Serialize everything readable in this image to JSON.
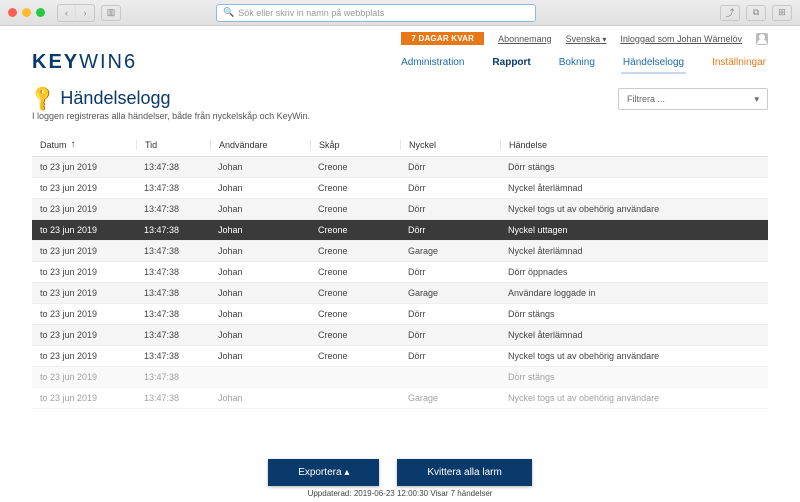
{
  "chrome": {
    "url_placeholder": "Sök eller skriv in namn på webbplats"
  },
  "util": {
    "days_badge": "7 DAGAR KVAR",
    "subscription": "Abonnemang",
    "language": "Svenska",
    "logged_in_as": "Inloggad som Johan Wärnelöv"
  },
  "logo": {
    "brand": "KEY",
    "brand2": "WIN",
    "ver": "6"
  },
  "nav": {
    "administration": "Administration",
    "rapport": "Rapport",
    "bokning": "Bokning",
    "handelselogg": "Händelselogg",
    "installningar": "Inställningar"
  },
  "page": {
    "title": "Händelselogg",
    "subtitle": "I loggen registreras alla händelser, både från nyckelskåp och KeyWin.",
    "filter_label": "Filtrera ..."
  },
  "columns": {
    "datum": "Datum",
    "tid": "Tid",
    "anvandare": "Andvändare",
    "skap": "Skåp",
    "nyckel": "Nyckel",
    "handelse": "Händelse"
  },
  "rows": [
    {
      "datum": "to 23 jun 2019",
      "tid": "13:47:38",
      "anv": "Johan",
      "skap": "Creone",
      "nyckel": "Dörr",
      "hand": "Dörr stängs",
      "sel": false
    },
    {
      "datum": "to 23 jun 2019",
      "tid": "13:47:38",
      "anv": "Johan",
      "skap": "Creone",
      "nyckel": "Dörr",
      "hand": "Nyckel återlämnad",
      "sel": false
    },
    {
      "datum": "to 23 jun 2019",
      "tid": "13:47:38",
      "anv": "Johan",
      "skap": "Creone",
      "nyckel": "Dörr",
      "hand": "Nyckel togs ut av obehörig användare",
      "sel": false
    },
    {
      "datum": "to 23 jun 2019",
      "tid": "13:47:38",
      "anv": "Johan",
      "skap": "Creone",
      "nyckel": "Dörr",
      "hand": "Nyckel uttagen",
      "sel": true
    },
    {
      "datum": "to 23 jun 2019",
      "tid": "13:47:38",
      "anv": "Johan",
      "skap": "Creone",
      "nyckel": "Garage",
      "hand": "Nyckel återlämnad",
      "sel": false
    },
    {
      "datum": "to 23 jun 2019",
      "tid": "13:47:38",
      "anv": "Johan",
      "skap": "Creone",
      "nyckel": "Dörr",
      "hand": "Dörr öppnades",
      "sel": false
    },
    {
      "datum": "to 23 jun 2019",
      "tid": "13:47:38",
      "anv": "Johan",
      "skap": "Creone",
      "nyckel": "Garage",
      "hand": "Användare loggade in",
      "sel": false
    },
    {
      "datum": "to 23 jun 2019",
      "tid": "13:47:38",
      "anv": "Johan",
      "skap": "Creone",
      "nyckel": "Dörr",
      "hand": "Dörr stängs",
      "sel": false
    },
    {
      "datum": "to 23 jun 2019",
      "tid": "13:47:38",
      "anv": "Johan",
      "skap": "Creone",
      "nyckel": "Dörr",
      "hand": "Nyckel återlämnad",
      "sel": false
    },
    {
      "datum": "to 23 jun 2019",
      "tid": "13:47:38",
      "anv": "Johan",
      "skap": "Creone",
      "nyckel": "Dörr",
      "hand": "Nyckel togs ut av obehörig användare",
      "sel": false
    },
    {
      "datum": "to 23 jun 2019",
      "tid": "13:47:38",
      "anv": "",
      "skap": "",
      "nyckel": "",
      "hand": "Dörr stängs",
      "sel": false,
      "faded": true
    },
    {
      "datum": "to 23 jun 2019",
      "tid": "13:47:38",
      "anv": "Johan",
      "skap": "",
      "nyckel": "Garage",
      "hand": "Nyckel togs ut av obehörig användare",
      "sel": false,
      "faded": true
    }
  ],
  "footer": {
    "export": "Exportera ▴",
    "ack": "Kvittera alla larm",
    "status": "Uppdaterad: 2019-06-23 12:00:30 Visar 7 händelser"
  }
}
